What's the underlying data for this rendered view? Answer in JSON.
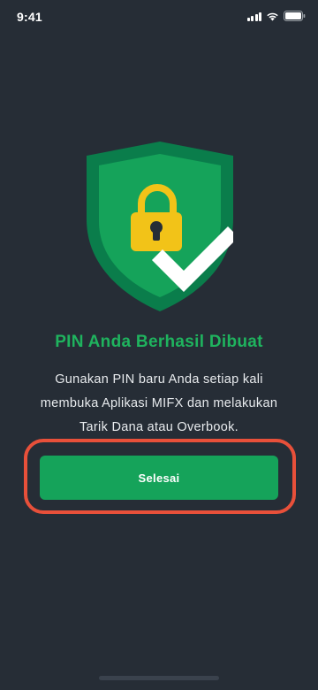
{
  "status_bar": {
    "time": "9:41"
  },
  "hero": {
    "icon": "shield-lock-check-icon",
    "colors": {
      "shield_outer": "#0a7d4b",
      "shield_inner": "#15a35a",
      "lock": "#f2c318",
      "check": "#ffffff"
    }
  },
  "content": {
    "title": "PIN Anda Berhasil Dibuat",
    "description_lines": [
      "Gunakan PIN baru Anda setiap kali",
      "membuka Aplikasi MIFX dan melakukan",
      "Tarik Dana atau Overbook."
    ]
  },
  "actions": {
    "done_label": "Selesai"
  },
  "theme": {
    "background": "#262d36",
    "accent": "#15a35a",
    "title_color": "#1fb35e",
    "highlight": "#e8503a"
  }
}
